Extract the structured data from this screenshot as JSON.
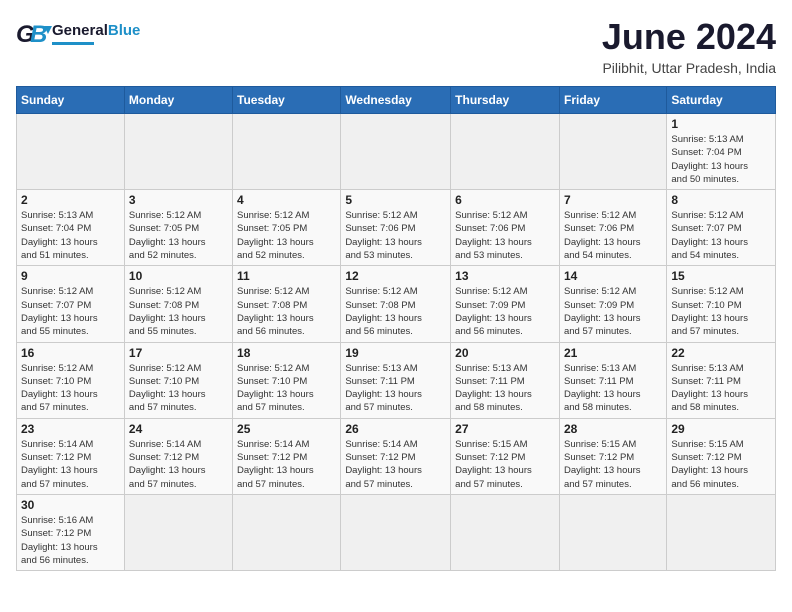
{
  "header": {
    "logo_general": "General",
    "logo_blue": "Blue",
    "month_year": "June 2024",
    "location": "Pilibhit, Uttar Pradesh, India"
  },
  "weekdays": [
    "Sunday",
    "Monday",
    "Tuesday",
    "Wednesday",
    "Thursday",
    "Friday",
    "Saturday"
  ],
  "days": [
    {
      "date": "",
      "content": ""
    },
    {
      "date": "",
      "content": ""
    },
    {
      "date": "",
      "content": ""
    },
    {
      "date": "",
      "content": ""
    },
    {
      "date": "",
      "content": ""
    },
    {
      "date": "",
      "content": ""
    },
    {
      "date": "1",
      "content": "Sunrise: 5:13 AM\nSunset: 7:04 PM\nDaylight: 13 hours\nand 50 minutes."
    },
    {
      "date": "2",
      "content": "Sunrise: 5:13 AM\nSunset: 7:04 PM\nDaylight: 13 hours\nand 51 minutes."
    },
    {
      "date": "3",
      "content": "Sunrise: 5:12 AM\nSunset: 7:05 PM\nDaylight: 13 hours\nand 52 minutes."
    },
    {
      "date": "4",
      "content": "Sunrise: 5:12 AM\nSunset: 7:05 PM\nDaylight: 13 hours\nand 52 minutes."
    },
    {
      "date": "5",
      "content": "Sunrise: 5:12 AM\nSunset: 7:06 PM\nDaylight: 13 hours\nand 53 minutes."
    },
    {
      "date": "6",
      "content": "Sunrise: 5:12 AM\nSunset: 7:06 PM\nDaylight: 13 hours\nand 53 minutes."
    },
    {
      "date": "7",
      "content": "Sunrise: 5:12 AM\nSunset: 7:06 PM\nDaylight: 13 hours\nand 54 minutes."
    },
    {
      "date": "8",
      "content": "Sunrise: 5:12 AM\nSunset: 7:07 PM\nDaylight: 13 hours\nand 54 minutes."
    },
    {
      "date": "9",
      "content": "Sunrise: 5:12 AM\nSunset: 7:07 PM\nDaylight: 13 hours\nand 55 minutes."
    },
    {
      "date": "10",
      "content": "Sunrise: 5:12 AM\nSunset: 7:08 PM\nDaylight: 13 hours\nand 55 minutes."
    },
    {
      "date": "11",
      "content": "Sunrise: 5:12 AM\nSunset: 7:08 PM\nDaylight: 13 hours\nand 56 minutes."
    },
    {
      "date": "12",
      "content": "Sunrise: 5:12 AM\nSunset: 7:08 PM\nDaylight: 13 hours\nand 56 minutes."
    },
    {
      "date": "13",
      "content": "Sunrise: 5:12 AM\nSunset: 7:09 PM\nDaylight: 13 hours\nand 56 minutes."
    },
    {
      "date": "14",
      "content": "Sunrise: 5:12 AM\nSunset: 7:09 PM\nDaylight: 13 hours\nand 57 minutes."
    },
    {
      "date": "15",
      "content": "Sunrise: 5:12 AM\nSunset: 7:10 PM\nDaylight: 13 hours\nand 57 minutes."
    },
    {
      "date": "16",
      "content": "Sunrise: 5:12 AM\nSunset: 7:10 PM\nDaylight: 13 hours\nand 57 minutes."
    },
    {
      "date": "17",
      "content": "Sunrise: 5:12 AM\nSunset: 7:10 PM\nDaylight: 13 hours\nand 57 minutes."
    },
    {
      "date": "18",
      "content": "Sunrise: 5:12 AM\nSunset: 7:10 PM\nDaylight: 13 hours\nand 57 minutes."
    },
    {
      "date": "19",
      "content": "Sunrise: 5:13 AM\nSunset: 7:11 PM\nDaylight: 13 hours\nand 57 minutes."
    },
    {
      "date": "20",
      "content": "Sunrise: 5:13 AM\nSunset: 7:11 PM\nDaylight: 13 hours\nand 58 minutes."
    },
    {
      "date": "21",
      "content": "Sunrise: 5:13 AM\nSunset: 7:11 PM\nDaylight: 13 hours\nand 58 minutes."
    },
    {
      "date": "22",
      "content": "Sunrise: 5:13 AM\nSunset: 7:11 PM\nDaylight: 13 hours\nand 58 minutes."
    },
    {
      "date": "23",
      "content": "Sunrise: 5:14 AM\nSunset: 7:12 PM\nDaylight: 13 hours\nand 57 minutes."
    },
    {
      "date": "24",
      "content": "Sunrise: 5:14 AM\nSunset: 7:12 PM\nDaylight: 13 hours\nand 57 minutes."
    },
    {
      "date": "25",
      "content": "Sunrise: 5:14 AM\nSunset: 7:12 PM\nDaylight: 13 hours\nand 57 minutes."
    },
    {
      "date": "26",
      "content": "Sunrise: 5:14 AM\nSunset: 7:12 PM\nDaylight: 13 hours\nand 57 minutes."
    },
    {
      "date": "27",
      "content": "Sunrise: 5:15 AM\nSunset: 7:12 PM\nDaylight: 13 hours\nand 57 minutes."
    },
    {
      "date": "28",
      "content": "Sunrise: 5:15 AM\nSunset: 7:12 PM\nDaylight: 13 hours\nand 57 minutes."
    },
    {
      "date": "29",
      "content": "Sunrise: 5:15 AM\nSunset: 7:12 PM\nDaylight: 13 hours\nand 56 minutes."
    },
    {
      "date": "30",
      "content": "Sunrise: 5:16 AM\nSunset: 7:12 PM\nDaylight: 13 hours\nand 56 minutes."
    },
    {
      "date": "",
      "content": ""
    },
    {
      "date": "",
      "content": ""
    },
    {
      "date": "",
      "content": ""
    },
    {
      "date": "",
      "content": ""
    },
    {
      "date": "",
      "content": ""
    },
    {
      "date": "",
      "content": ""
    }
  ]
}
